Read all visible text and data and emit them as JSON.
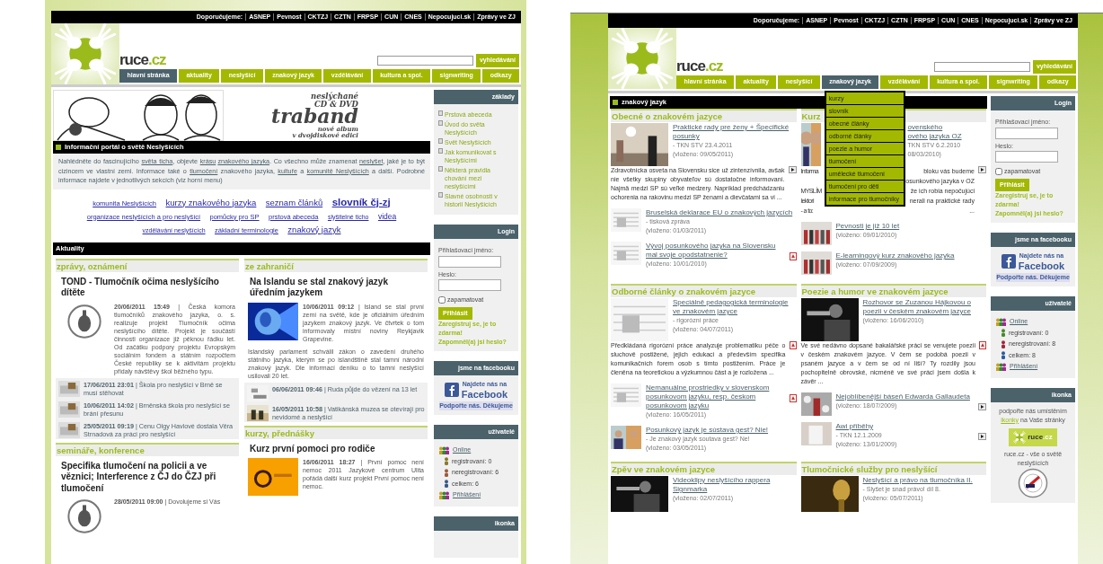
{
  "pages": [
    {
      "top_bar": {
        "label": "Doporučujeme:",
        "links": [
          "ASNEP",
          "Pevnost",
          "CKTZJ",
          "CZTN",
          "FRPSP",
          "CUN",
          "CNES",
          "Nepocujuci.sk",
          "Zprávy ve ZJ"
        ]
      },
      "brand": {
        "name": "ruce",
        "suffix": ".cz"
      },
      "search": {
        "button": "vyhledávání"
      },
      "nav": [
        {
          "label": "hlavní stránka",
          "selected": true
        },
        {
          "label": "aktuality",
          "selected": false
        },
        {
          "label": "neslyšící",
          "selected": false
        },
        {
          "label": "znakový jazyk",
          "selected": false
        },
        {
          "label": "vzdělávání",
          "selected": false
        },
        {
          "label": "kultura a spol.",
          "selected": false
        },
        {
          "label": "signwriting",
          "selected": false
        },
        {
          "label": "odkazy",
          "selected": false
        }
      ],
      "main": {
        "kind": "home",
        "banner": {
          "lines": [
            "neslýchané",
            "CD & DVD",
            "traband",
            "nové album",
            "v dvojdiskové edici"
          ]
        },
        "portal_title": "Informační portál o světě Neslyšících",
        "intro": [
          {
            "text": "Nahlédněte do fascinujícího "
          },
          {
            "link": "světa ticha"
          },
          {
            "text": ", objevte "
          },
          {
            "link": "krásu"
          },
          {
            "link": "znakového jazyka"
          },
          {
            "text": ". Co všechno může znamenat "
          },
          {
            "link": "neslyšet"
          },
          {
            "text": ", jaké je to být cizincem ve vlastní zemi. Informace také o "
          },
          {
            "link": "tlumočení"
          },
          {
            "text": " znakového jazyka, "
          },
          {
            "link": "kultuře"
          },
          {
            "text": " a "
          },
          {
            "link": "komunitě Neslyšících"
          },
          {
            "text": " a další. Podrobné informace najdete v jednotlivých sekcích (viz horní menu)"
          }
        ],
        "tags": [
          {
            "label": "komunita Neslyšících",
            "kind": "small"
          },
          {
            "label": "kurzy znakového jazyka",
            "kind": "large"
          },
          {
            "label": "seznam článků",
            "kind": "large"
          },
          {
            "label": "slovník čj-zj",
            "kind": "huge"
          },
          {
            "label": "organizace neslyšících a pro neslyšící",
            "kind": "small"
          },
          {
            "label": "pomůcky pro SP",
            "kind": "small"
          },
          {
            "label": "prstová abeceda",
            "kind": "small"
          },
          {
            "label": "slyšitelné ticho",
            "kind": "tiny"
          },
          {
            "label": "videa",
            "kind": "medium"
          },
          {
            "label": "vzdělávání neslyšících",
            "kind": "tiny"
          },
          {
            "label": "základní terminologie",
            "kind": "small"
          },
          {
            "label": "znakový jazyk",
            "kind": "large"
          }
        ],
        "news_title": "Aktuality",
        "columns": [
          [
            {
              "heading": "zprávy, oznámení",
              "featured": {
                "title": "TOND - Tlumočník očima neslyšícího dítěte",
                "paragraphs": [
                  "**20/06/2011 15:49** | Česká komora tlumočníků znakového jazyka, o. s. realizuje projekt Tlumočník očima neslyšícího dítěte. Projekt je součástí činnosti organizace již pěknou řádku let. Od začátku podpory projektu Evropským sociálním fondem a státním rozpočtem České republiky se k aktivitám projektu přidaly návštěvy škol běžného typu."
                ]
              },
              "items": [
                "**17/06/2011 23:01** | Škola pro neslyšící v Brně se musí stěhovat",
                "**10/06/2011 14:02** | Brněnská škola pro neslyšící se brání přesunu",
                "**25/05/2011 09:19** | Cenu Olgy Havlové dostala Věra Strnadová za práci pro neslyšící"
              ]
            },
            {
              "heading": "semináře, konference",
              "featured": {
                "title": "Specifika tlumočení na policii a ve věznici; Interference z ČJ do ČZJ při tlumočení",
                "paragraphs": [
                  "**28/05/2011 09:00** | Dovolujeme si Vás"
                ]
              }
            }
          ],
          [
            {
              "heading": "ze zahraničí",
              "featured": {
                "title": "Na Islandu se stal znakový jazyk úředním jazykem",
                "paragraphs": [
                  "**10/06/2011 09:12** | Island se stal první zemí na světě, kde je oficiálním úředním jazykem znakový jazyk. Ve čtvrtek o tom informovaly místní noviny Reykjavik Grapevine.",
                  "Islandský parlament schválil zákon o zavedení druhého státního jazyka, kterým se po islandštině stal tamní národní znakový jazyk. Dle informací deníku o to tamní neslyšící usilovali 20 let."
                ]
              },
              "items": [
                "**06/06/2011 09:46** | Ruda půjde do vězení na 13 let",
                "**16/05/2011 10:58** | Vatikánská muzea se otevírají pro nevidomé a neslyšící"
              ]
            },
            {
              "heading": "kurzy, přednášky",
              "featured": {
                "title": "Kurz první pomoci pro rodiče",
                "paragraphs": [
                  "**16/06/2011 18:27** | První pomoc není nemoc 2011 Jazykové centrum Ulita pořádá další kurz projekt První pomoc není nemoc."
                ]
              }
            }
          ]
        ]
      },
      "sidebar": [
        {
          "kind": "links",
          "title": "základy",
          "links": [
            "Prstová abeceda",
            "Úvod do světa Neslyšících",
            "Svět Neslyšících",
            "Jak komunikovat s Neslyšícími",
            "Některá pravidla chování mezi neslyšícími",
            "Slavné osobnosti v historii Neslyšících"
          ]
        },
        {
          "kind": "login",
          "title": "Login",
          "user_label": "Přihlašovací jméno:",
          "password_label": "Heslo:",
          "remember": {
            "label": "zapamatovat",
            "checked": false
          },
          "button": "Přihlásit",
          "links": [
            "Zaregistruj se, je to zdarma!",
            "Zapomněl(a) jsi heslo?"
          ]
        },
        {
          "kind": "facebook",
          "title": "jsme na facebooku",
          "small": "Najdete nás na",
          "big": "Facebook",
          "caption": "Podpořte nás. Děkujeme"
        },
        {
          "kind": "users",
          "title": "uživatelé",
          "online": "Online",
          "rows": [
            {
              "text": "registrovaní: 0",
              "color": "#8a7a2a"
            },
            {
              "text": "neregistrovaní: 6",
              "color": "#a05a3a"
            },
            {
              "text": "celkem: 6",
              "color": "#3a5a8a"
            }
          ],
          "logged": "Přihlášení"
        },
        {
          "kind": "ikonka",
          "title": "ikonka"
        }
      ]
    },
    {
      "top_bar": {
        "label": "Doporučujeme:",
        "links": [
          "ASNEP",
          "Pevnost",
          "CKTZJ",
          "CZTN",
          "FRPSP",
          "CUN",
          "CNES",
          "Nepocujuci.sk",
          "Zprávy ve ZJ"
        ]
      },
      "brand": {
        "name": "ruce",
        "suffix": ".cz"
      },
      "search": {
        "button": "vyhledávání"
      },
      "nav": [
        {
          "label": "hlavní stránka",
          "selected": false
        },
        {
          "label": "aktuality",
          "selected": false
        },
        {
          "label": "neslyšící",
          "selected": false
        },
        {
          "label": "znakový jazyk",
          "selected": true,
          "menu": [
            "kurzy",
            "slovník",
            "obecné články",
            "odborné články",
            "poezie a humor",
            "tlumočení",
            "umělecké tlumočení",
            "tlumočení pro děti",
            "informace pro tlumočníky"
          ]
        },
        {
          "label": "vzdělávání",
          "selected": false
        },
        {
          "label": "kultura a spol.",
          "selected": false
        },
        {
          "label": "signwriting",
          "selected": false
        },
        {
          "label": "odkazy",
          "selected": false
        }
      ],
      "main": {
        "kind": "section",
        "title": "znakový jazyk",
        "blocks": [
          {
            "kind": "full",
            "heading": "Obecné o znakovém jazyce",
            "featured": {
              "title": "Praktické rady pre ženy + Špecifické posunky",
              "source": "- TKN STV 23.4.2011",
              "date": "(vloženo: 09/05/2011)",
              "attachment": {
                "kind": "video"
              },
              "text": "Zdravotnícka osveta na Slovensku sice už zintenzívnila, avšak nie všetky skupiny obyvateľov sú dostatočne informovaní. Najmä medzi SP sú veľké medzery. Napríklad predchádzaniu ochorenia na rakovinu medzi SP ženami a dievčatami sa vi ..."
            },
            "items": [
              {
                "title": "Bruselská deklarace EU o znakových jazycích",
                "source": "- tisková zpráva",
                "date": "(vloženo: 01/03/2011)"
              },
              {
                "title": "Vývoj posunkového jazyka na Slovensku mal svoje opodstatnenie?",
                "date": "(vloženo: 10/01/2010)",
                "attachment": {
                  "kind": "pdf"
                }
              }
            ]
          },
          {
            "kind": "covered",
            "heading": "Kurz",
            "featured": {
              "title_lines": [
                "ovenského",
                "ového jazyka OZ"
              ],
              "meta_lines": [
                "TKN STV 6.2.2010",
                "08/03/2010)"
              ],
              "attachment": {
                "kind": "video"
              },
              "text_lines": [
                {
                  "left": "Informa",
                  "right": "bloku vás budeme"
                },
                {
                  "right": "osunkového jazyka v OZ"
                },
                {
                  "left": "MYSLÍM",
                  "right": "že ich robia nepočujúci"
                },
                {
                  "left": "lektori",
                  "right": "nerali na praktické rady"
                },
                {
                  "left": "- a to:",
                  "right": "..."
                }
              ]
            },
            "items": [
              {
                "title": "Pevnosti je již 10 let",
                "date": "(vloženo: 09/01/2010)"
              },
              {
                "title": "E-learningový kurz znakového jazyka",
                "date": "(vloženo: 07/09/2009)"
              }
            ]
          },
          {
            "kind": "full",
            "heading": "Odborné články o znakovém jazyce",
            "featured": {
              "title": "Speciálně pedagogická terminologie ve znakovém jazyce",
              "source": "- rigorózní práce",
              "date": "(vloženo: 04/07/2011)",
              "attachment": {
                "kind": "pdf"
              },
              "text": "Předkládaná rigorózní práce analyzuje problematiku péče o sluchově postižené, jejich edukaci a především specifika komunikačních forem osob s tímto postižením. Práce je členěna na teoretickou a výzkumnou část a je rozložena ..."
            },
            "items": [
              {
                "title": "Nemanuálne prostriedky v slovenskom posunkovom jazyku, resp. českom posunkovom jazyku",
                "date": "(vloženo: 16/05/2011)",
                "attachment": {
                  "kind": "pdf"
                }
              },
              {
                "title": "Posunkový jazyk je sústava gest? Nie!",
                "source": "- Je znakový jazyk soutava gest? Ne!",
                "date": "(vloženo: 03/05/2011)"
              }
            ]
          },
          {
            "kind": "full",
            "heading": "Poezie a humor ve znakovém jazyce",
            "featured": {
              "title": "Rozhovor se Zuzanou Hájkovou o poezii v českém znakovém jazyce",
              "date": "(vloženo: 16/06/2010)",
              "attachment": {
                "kind": "pdf"
              },
              "text": "Ve své nedávno dopsané bakalářské práci se venujete poezii v českém znakovém jazyce. V čem se podobá poezii v psaném jazyce a v čem se od ní liší? Ty rozdíly jsou pochopitelně obrovské, nicméně ve své práci jsem došla k závěr ..."
            },
            "items": [
              {
                "title": "Nejoblíbenější báseň Edwarda Gallaudeta",
                "date": "(vloženo: 18/07/2009)",
                "attachment": {
                  "kind": "video"
                }
              },
              {
                "title": "Awi příběhy",
                "source": "- TKN 12.1.2009",
                "date": "(vloženo: 13/01/2009)",
                "attachment": {
                  "kind": "video"
                }
              }
            ]
          },
          {
            "kind": "full",
            "heading": "Zpěv ve znakovém jazyce",
            "featured": {
              "title": "Videoklipy neslyšícího rappera Signmarka",
              "date": "(vloženo: 02/07/2011)"
            }
          },
          {
            "kind": "full",
            "heading": "Tlumočnické služby pro neslyšící",
            "featured": {
              "title": "Neslyšící a právo na tlumočníka II.",
              "source": "- Slyšet je snad právo! díl 8.",
              "date": "(vloženo: 05/07/2011)"
            }
          }
        ]
      },
      "sidebar": [
        {
          "kind": "login",
          "title": "Login",
          "user_label": "Přihlašovací jméno:",
          "password_label": "Heslo:",
          "remember": {
            "label": "zapamatovat",
            "checked": false
          },
          "button": "Přihlásit",
          "links": [
            "Zaregistruj se, je to zdarma!",
            "Zapomněl(a) jsi heslo?"
          ]
        },
        {
          "kind": "facebook",
          "title": "jsme na facebooku",
          "small": "Najdete nás na",
          "big": "Facebook",
          "caption": "Podpořte nás. Děkujeme"
        },
        {
          "kind": "users",
          "title": "uživatelé",
          "online": "Online",
          "rows": [
            {
              "text": "registrovaní: 0",
              "color": "#4a8a2a"
            },
            {
              "text": "neregistrovaní: 8",
              "color": "#a02a3a"
            },
            {
              "text": "celkem: 8",
              "color": "#2a5aa0"
            }
          ],
          "logged": "Přihlášení"
        },
        {
          "kind": "ikonka",
          "title": "ikonka",
          "before": "podpořte nás umístěním",
          "link": "ikonky",
          "after": "na Vaše stránky",
          "badge": {
            "name": "ruce",
            "suffix": ".cz"
          },
          "caption": "ruce.cz - vše o světě neslyšících"
        }
      ]
    }
  ]
}
